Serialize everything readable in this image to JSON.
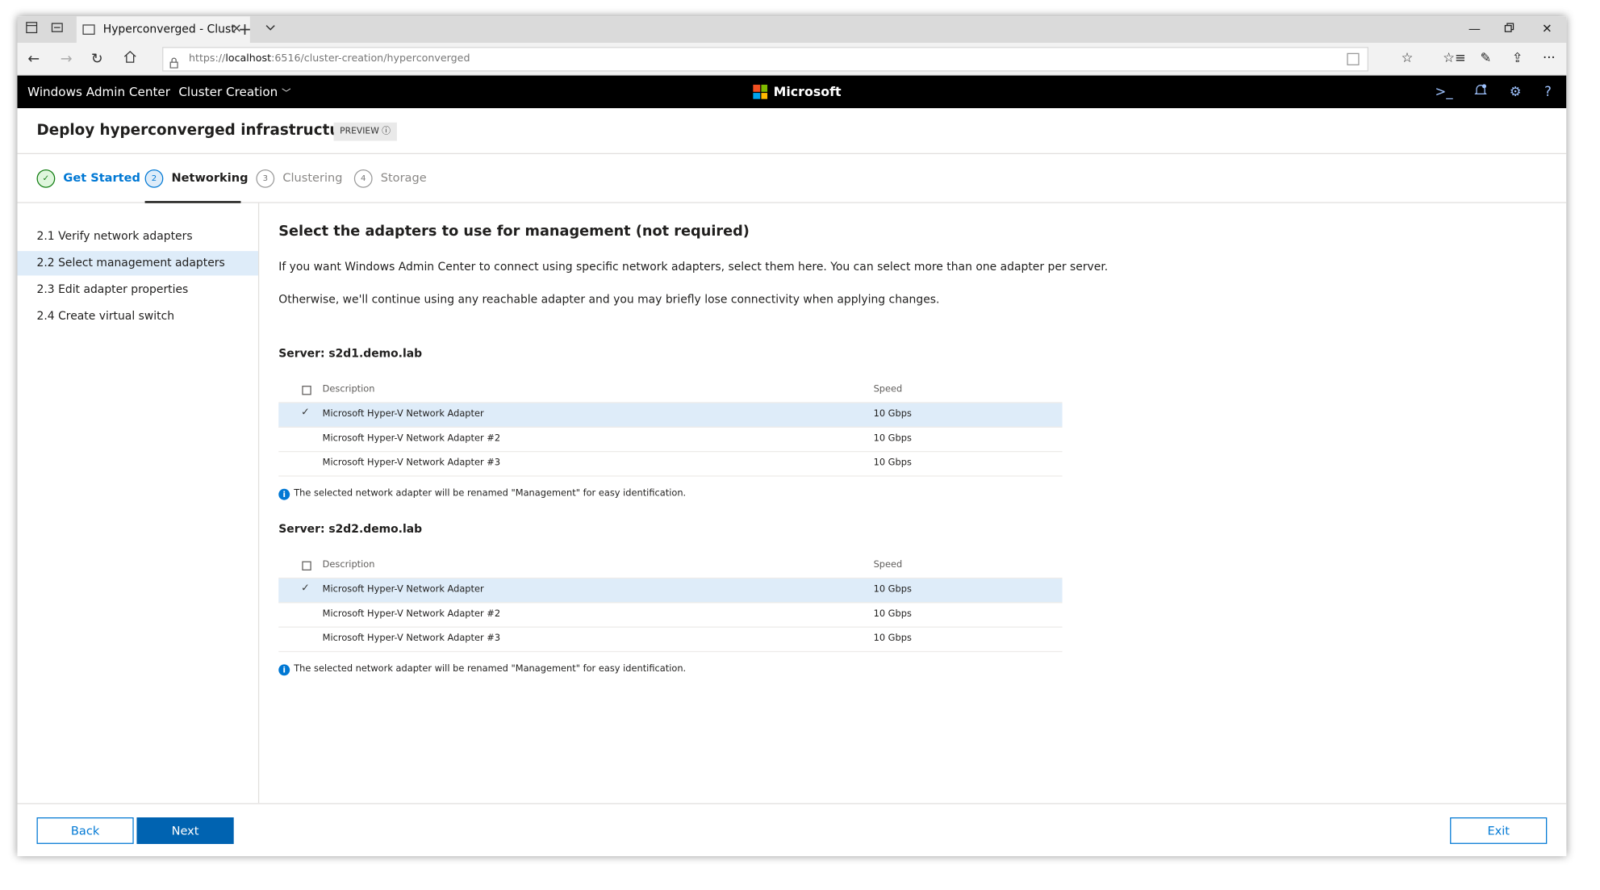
{
  "browser": {
    "tab_title": "Hyperconverged - Clust",
    "url_prefix": "https://",
    "url_host": "localhost",
    "url_rest": ":6516/cluster-creation/hyperconverged",
    "icons": [
      "tab-set-aside-icon",
      "tab-preview-icon",
      "favicon",
      "close-icon",
      "new-tab-icon",
      "chevron-down-icon",
      "minimize-icon",
      "restore-icon",
      "window-close-icon",
      "back-icon",
      "forward-icon",
      "refresh-icon",
      "home-icon",
      "lock-icon",
      "reading-view-icon",
      "favorite-star-icon",
      "favorites-hub-icon",
      "pen-icon",
      "share-icon",
      "more-icon"
    ]
  },
  "header": {
    "brand": "Windows Admin Center",
    "section": "Cluster Creation",
    "microsoft": "Microsoft",
    "logo_colors": [
      "#f25022",
      "#7fba00",
      "#00a4ef",
      "#ffb900"
    ],
    "icons": [
      "powershell-icon",
      "notifications-icon",
      "settings-icon",
      "help-icon"
    ]
  },
  "page": {
    "title": "Deploy hyperconverged infrastructure",
    "badge": "PREVIEW"
  },
  "steps": [
    {
      "number": "✓",
      "label": "Get Started",
      "state": "done"
    },
    {
      "number": "2",
      "label": "Networking",
      "state": "active"
    },
    {
      "number": "3",
      "label": "Clustering",
      "state": "pending"
    },
    {
      "number": "4",
      "label": "Storage",
      "state": "pending"
    }
  ],
  "leftnav": [
    {
      "label": "2.1  Verify network adapters",
      "selected": false
    },
    {
      "label": "2.2  Select management adapters",
      "selected": true
    },
    {
      "label": "2.3  Edit adapter properties",
      "selected": false
    },
    {
      "label": "2.4  Create virtual switch",
      "selected": false
    }
  ],
  "main": {
    "title": "Select the adapters to use for management (not required)",
    "para1": "If you want Windows Admin Center to connect using specific network adapters, select them here. You can select more than one adapter per server.",
    "para2": "Otherwise, we'll continue using any reachable adapter and you may briefly lose connectivity when applying changes.",
    "col_description": "Description",
    "col_speed": "Speed",
    "note": "The selected network adapter will be renamed \"Management\" for easy identification.",
    "servers": [
      {
        "label": "Server: s2d1.demo.lab",
        "adapters": [
          {
            "description": "Microsoft Hyper-V Network Adapter",
            "speed": "10 Gbps",
            "selected": true
          },
          {
            "description": "Microsoft Hyper-V Network Adapter #2",
            "speed": "10 Gbps",
            "selected": false
          },
          {
            "description": "Microsoft Hyper-V Network Adapter #3",
            "speed": "10 Gbps",
            "selected": false
          }
        ]
      },
      {
        "label": "Server: s2d2.demo.lab",
        "adapters": [
          {
            "description": "Microsoft Hyper-V Network Adapter",
            "speed": "10 Gbps",
            "selected": true
          },
          {
            "description": "Microsoft Hyper-V Network Adapter #2",
            "speed": "10 Gbps",
            "selected": false
          },
          {
            "description": "Microsoft Hyper-V Network Adapter #3",
            "speed": "10 Gbps",
            "selected": false
          }
        ]
      }
    ]
  },
  "footer": {
    "back": "Back",
    "next": "Next",
    "exit": "Exit"
  }
}
